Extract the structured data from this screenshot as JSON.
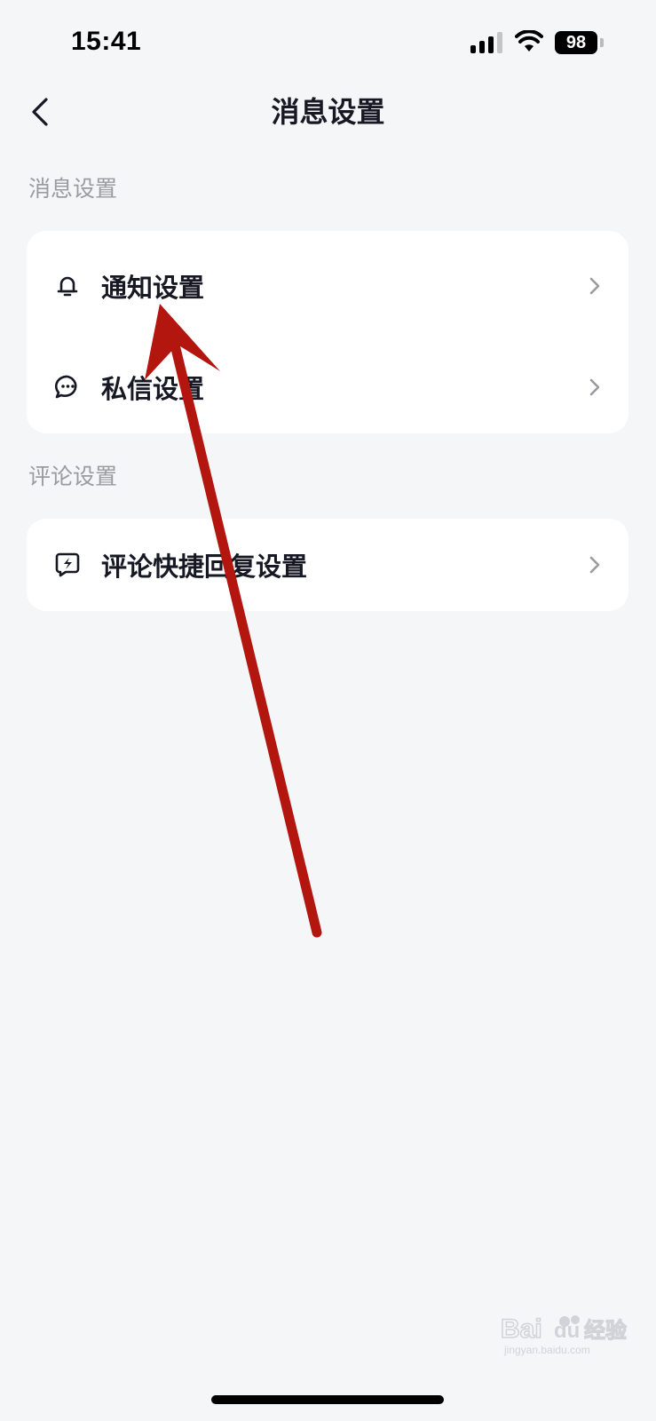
{
  "status_bar": {
    "time": "15:41",
    "battery": "98",
    "icons": [
      "cellular-signal-icon",
      "wifi-icon",
      "battery-icon"
    ]
  },
  "nav": {
    "title": "消息设置",
    "back_icon": "chevron-left-icon"
  },
  "sections": [
    {
      "label": "消息设置",
      "items": [
        {
          "label": "通知设置",
          "icon": "bell-icon"
        },
        {
          "label": "私信设置",
          "icon": "chat-bubble-icon"
        }
      ]
    },
    {
      "label": "评论设置",
      "items": [
        {
          "label": "评论快捷回复设置",
          "icon": "quick-reply-icon"
        }
      ]
    }
  ],
  "annotation": {
    "color": "#b3160f",
    "points_to": "通知设置"
  },
  "watermark": {
    "text": "Baidu 经验",
    "url": "jingyan.baidu.com"
  },
  "colors": {
    "background": "#f5f6f8",
    "card": "#ffffff",
    "text_primary": "#161823",
    "text_secondary": "#9a9ba1"
  }
}
